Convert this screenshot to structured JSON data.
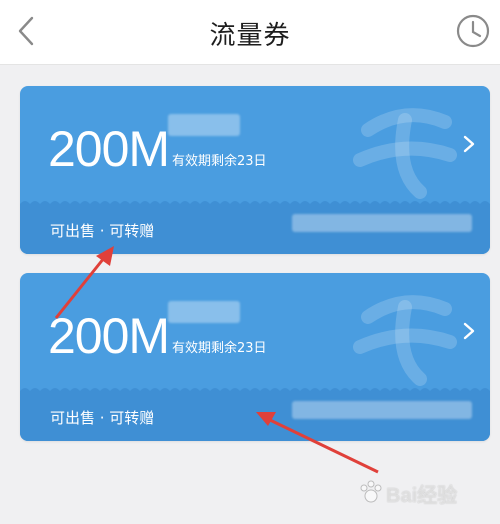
{
  "header": {
    "title": "流量券",
    "back_icon": "chevron-left-icon",
    "history_icon": "clock-icon"
  },
  "colors": {
    "card": "#4a9de0",
    "card_bottom": "#3f8fd4",
    "arrow": "#e0403a",
    "background": "#f0f0f2"
  },
  "coupons": [
    {
      "amount": "200M",
      "validity": "有效期剩余23日",
      "tags": "可出售 · 可转赠"
    },
    {
      "amount": "200M",
      "validity": "有效期剩余23日",
      "tags": "可出售 · 可转赠"
    }
  ],
  "watermark": {
    "text": "Bai经验"
  }
}
